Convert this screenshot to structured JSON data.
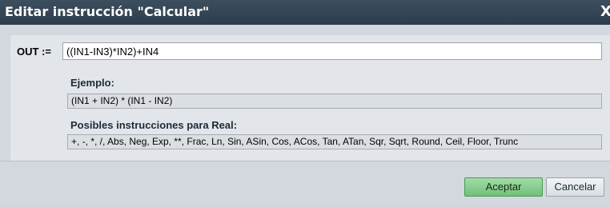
{
  "dialog": {
    "title": "Editar instrucción \"Calcular\"",
    "close_glyph": "X"
  },
  "out": {
    "label": "OUT :=",
    "value": "((IN1-IN3)*IN2)+IN4"
  },
  "example": {
    "heading": "Ejemplo:",
    "text": "(IN1 + IN2) * (IN1 - IN2)"
  },
  "instructions": {
    "heading": "Posibles instrucciones para Real:",
    "text": "+, -, *, /, Abs, Neg, Exp, **, Frac, Ln, Sin, ASin, Cos, ACos, Tan, ATan, Sqr, Sqrt, Round, Ceil, Floor, Trunc"
  },
  "buttons": {
    "accept": "Aceptar",
    "cancel": "Cancelar"
  },
  "colors": {
    "titlebar": "#2f3f4e",
    "accept_button": "#7fca86",
    "dialog_background": "#d3d8de"
  }
}
